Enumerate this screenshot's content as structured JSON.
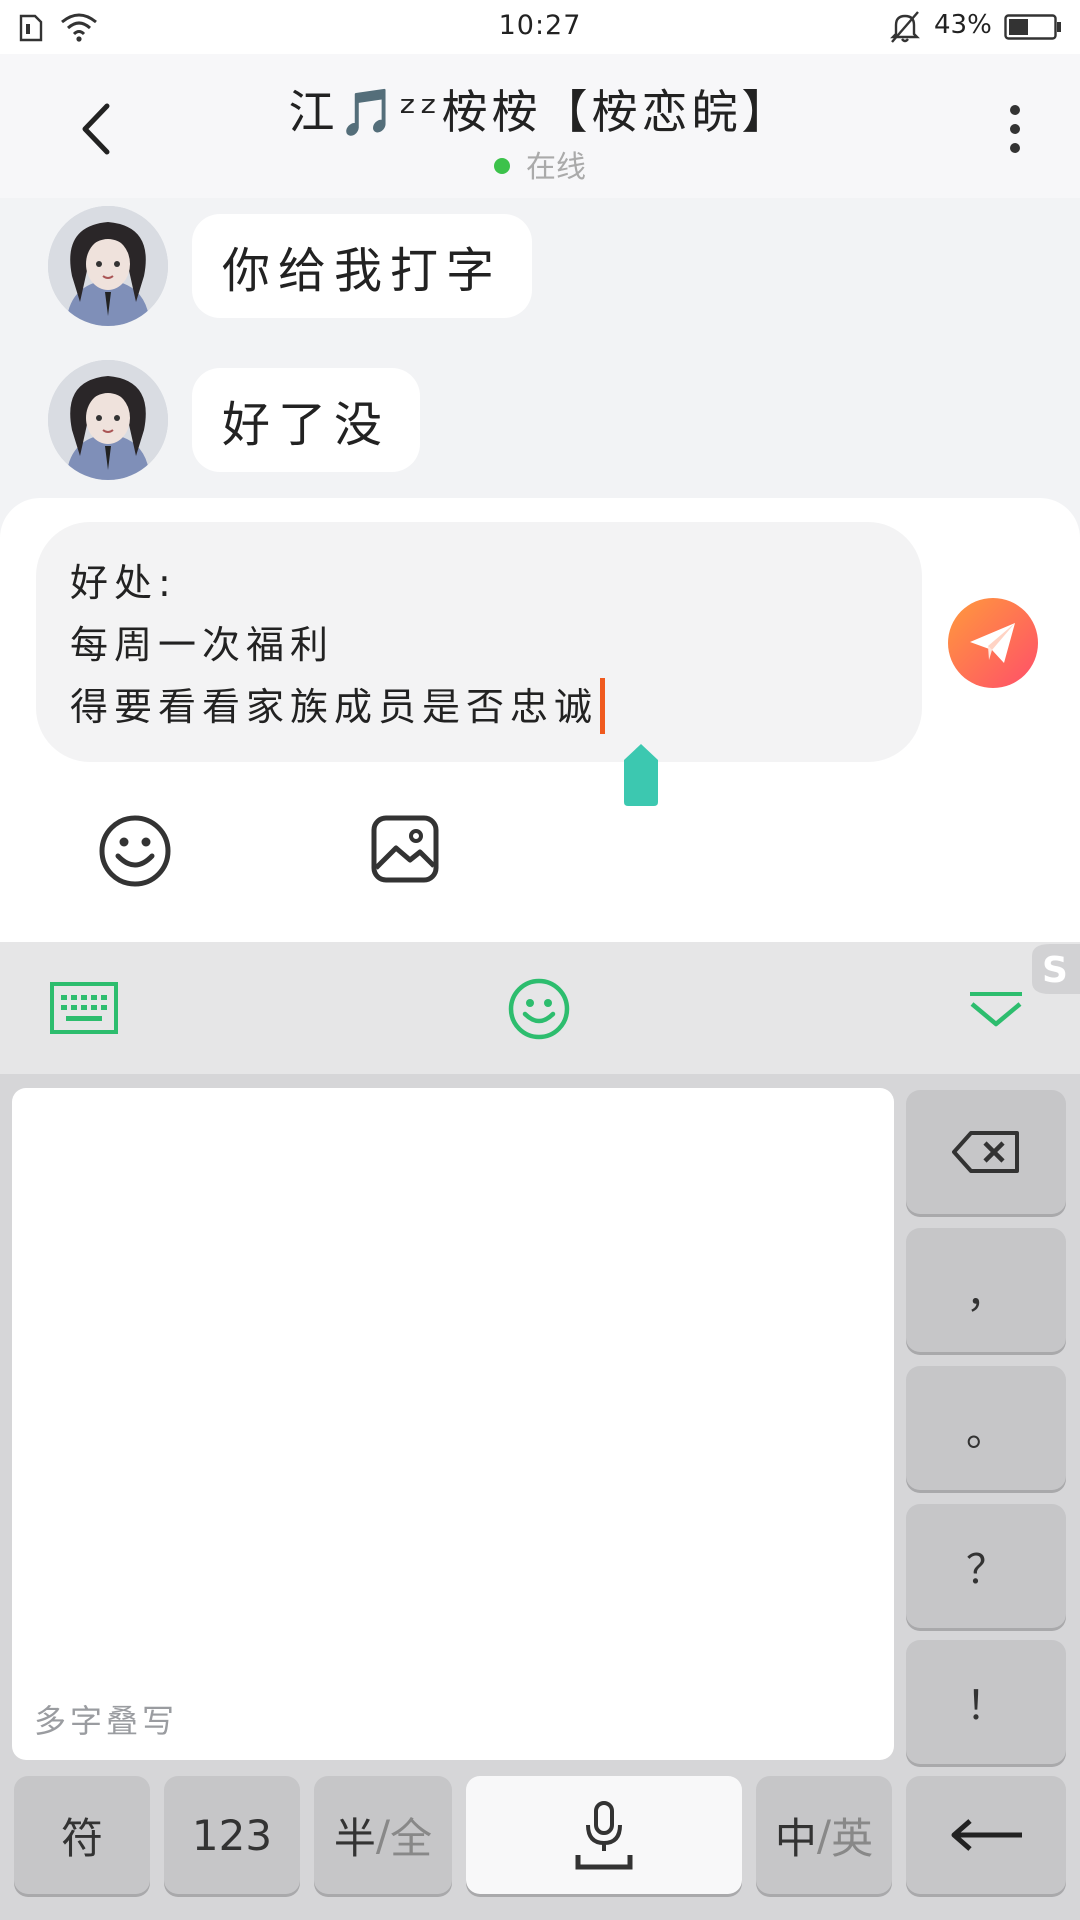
{
  "status_bar": {
    "time": "10:27",
    "battery_percent": "43%",
    "battery_level": 0.43
  },
  "header": {
    "title": "江🎵ᶻᶻ桉桉【桉恋皖】",
    "online_status": "在线",
    "online_color": "#3cc24b"
  },
  "messages": [
    {
      "text": "你给我打字"
    },
    {
      "text": "好了没"
    }
  ],
  "composer": {
    "input_lines": [
      "好处:",
      "每周一次福利",
      "得要看看家族成员是否忠诚"
    ],
    "send_colors": [
      "#ff9a3c",
      "#ff4e6a"
    ]
  },
  "keyboard": {
    "accent": "#2dbd6e",
    "handwriting_hint": "多字叠写",
    "side_keys": [
      {
        "name": "backspace",
        "label": ""
      },
      {
        "name": "comma",
        "label": "，"
      },
      {
        "name": "period",
        "label": "。"
      },
      {
        "name": "question",
        "label": "？"
      },
      {
        "name": "exclamation",
        "label": "！"
      }
    ],
    "bottom_keys": {
      "symbol": "符",
      "numbers": "123",
      "half": "半",
      "full": "全",
      "chinese": "中",
      "english": "英",
      "slash": "/"
    }
  }
}
